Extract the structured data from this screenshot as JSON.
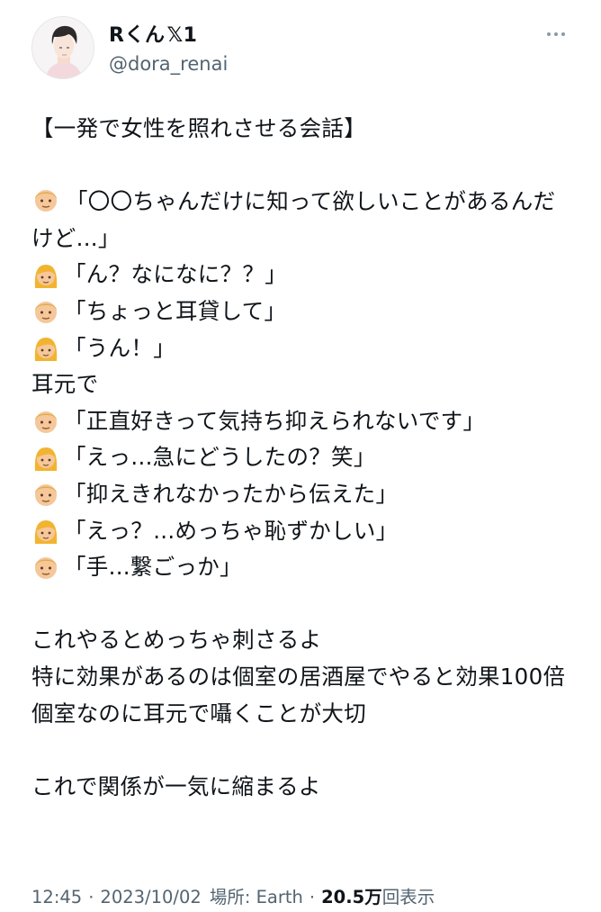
{
  "author": {
    "display_name": "Rくん",
    "badge": "𝕏1",
    "handle": "@dora_renai"
  },
  "tweet": {
    "title": "【一発で女性を照れさせる会話】",
    "dialogue": [
      {
        "speaker": "man-emoji",
        "text": "「〇〇ちゃんだけに知って欲しいことがあるんだけど...」"
      },
      {
        "speaker": "woman-emoji",
        "text": "「ん？なになに？？」"
      },
      {
        "speaker": "man-emoji",
        "text": "「ちょっと耳貸して」"
      },
      {
        "speaker": "woman-emoji",
        "text": "「うん！」"
      },
      {
        "speaker": "",
        "text": "耳元で"
      },
      {
        "speaker": "man-emoji",
        "text": "「正直好きって気持ち抑えられないです」"
      },
      {
        "speaker": "woman-emoji",
        "text": "「えっ...急にどうしたの？笑」"
      },
      {
        "speaker": "man-emoji",
        "text": "「抑えきれなかったから伝えた」"
      },
      {
        "speaker": "woman-emoji",
        "text": "「えっ？...めっちゃ恥ずかしい」"
      },
      {
        "speaker": "man-emoji",
        "text": "「手...繋ごっか」"
      }
    ],
    "tips": [
      "これやるとめっちゃ刺さるよ",
      "特に効果があるのは個室の居酒屋でやると効果100倍",
      "個室なのに耳元で囁くことが大切"
    ],
    "closing": "これで関係が一気に縮まるよ"
  },
  "meta": {
    "time": "12:45",
    "separator": "·",
    "date": "2023/10/02",
    "location": "場所: Earth",
    "views_count": "20.5万",
    "views_label": "回表示"
  },
  "colors": {
    "text": "#0f1419",
    "secondary": "#536471",
    "man_face": "#f5c79a",
    "man_hair": "#e0ac48",
    "woman_hair": "#f2b430"
  }
}
